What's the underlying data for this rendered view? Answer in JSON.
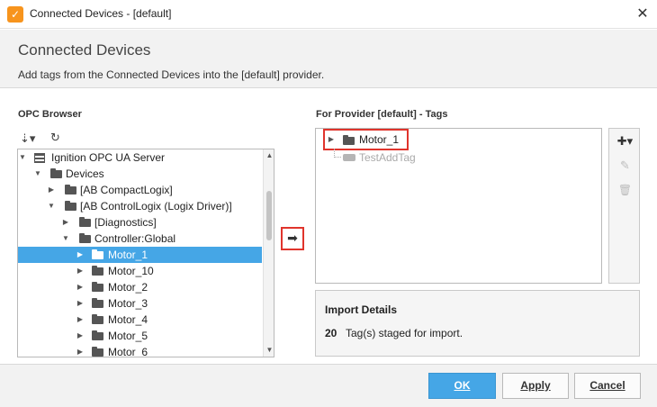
{
  "window": {
    "title": "Connected Devices - [default]",
    "app_icon": "ignition-icon",
    "close_glyph": "✕"
  },
  "header": {
    "title": "Connected Devices",
    "description": "Add tags from the Connected Devices into the [default] provider."
  },
  "left_panel": {
    "label": "OPC Browser",
    "toolbar": {
      "sort_glyph": "⇣▾",
      "refresh_glyph": "↻"
    },
    "tree": [
      {
        "label": "Ignition OPC UA Server",
        "expanded": true,
        "icon": "server-icon"
      },
      {
        "label": "Devices",
        "expanded": true,
        "icon": "folder-icon"
      },
      {
        "label": "[AB CompactLogix]",
        "expanded": false,
        "icon": "folder-icon"
      },
      {
        "label": "[AB ControlLogix (Logix Driver)]",
        "expanded": true,
        "icon": "folder-icon"
      },
      {
        "label": "[Diagnostics]",
        "expanded": false,
        "icon": "folder-icon"
      },
      {
        "label": "Controller:Global",
        "expanded": true,
        "icon": "folder-icon"
      },
      {
        "label": "Motor_1",
        "expanded": false,
        "icon": "folder-icon",
        "selected": true
      },
      {
        "label": "Motor_10",
        "expanded": false,
        "icon": "folder-icon"
      },
      {
        "label": "Motor_2",
        "expanded": false,
        "icon": "folder-icon"
      },
      {
        "label": "Motor_3",
        "expanded": false,
        "icon": "folder-icon"
      },
      {
        "label": "Motor_4",
        "expanded": false,
        "icon": "folder-icon"
      },
      {
        "label": "Motor_5",
        "expanded": false,
        "icon": "folder-icon"
      },
      {
        "label": "Motor_6",
        "expanded": false,
        "icon": "folder-icon"
      }
    ]
  },
  "transfer_button": {
    "glyph": "➡"
  },
  "right_panel": {
    "label": "For Provider [default] - Tags",
    "tags": [
      {
        "label": "Motor_1",
        "icon": "folder-icon"
      },
      {
        "label": "TestAddTag",
        "icon": "tag-icon"
      }
    ],
    "tools": {
      "add_glyph": "✚▾",
      "edit_glyph": "✎",
      "delete_glyph": "🗑"
    }
  },
  "import_details": {
    "title": "Import Details",
    "count": "20",
    "text": "Tag(s) staged for import."
  },
  "footer": {
    "ok_label": "OK",
    "apply_label": "Apply",
    "cancel_label": "Cancel"
  },
  "colors": {
    "accent": "#45a6e6",
    "highlight": "#e0342c",
    "app_icon": "#f7941d"
  }
}
